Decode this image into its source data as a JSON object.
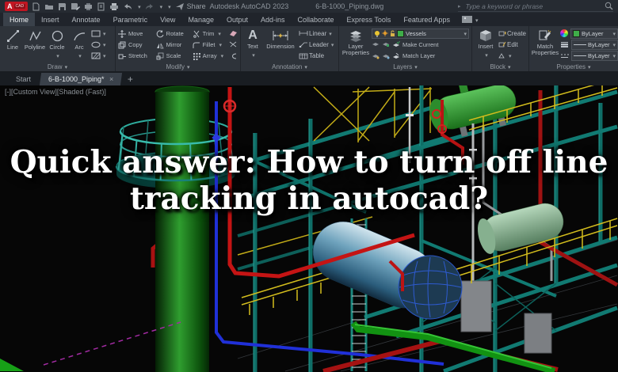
{
  "titlebar": {
    "app_title": "Autodesk AutoCAD 2023",
    "doc_title": "6-B-1000_Piping.dwg",
    "share_label": "Share",
    "search_placeholder": "Type a keyword or phrase",
    "qat_icons": [
      "new-file",
      "open-folder",
      "save",
      "save-as",
      "plot",
      "page",
      "print",
      "undo",
      "redo",
      "share"
    ]
  },
  "ribbon_tabs": {
    "tabs": [
      "Home",
      "Insert",
      "Annotate",
      "Parametric",
      "View",
      "Manage",
      "Output",
      "Add-ins",
      "Collaborate",
      "Express Tools",
      "Featured Apps"
    ],
    "active_tab": "Home"
  },
  "ribbon": {
    "draw": {
      "title": "Draw",
      "buttons": [
        "Line",
        "Polyline",
        "Circle",
        "Arc"
      ]
    },
    "modify": {
      "title": "Modify",
      "items": [
        "Move",
        "Copy",
        "Stretch",
        "Rotate",
        "Mirror",
        "Scale",
        "Trim",
        "Fillet",
        "Array"
      ]
    },
    "annotation": {
      "title": "Annotation",
      "text_label": "Text",
      "dimension_label": "Dimension",
      "items": [
        "Linear",
        "Leader",
        "Table"
      ]
    },
    "layers": {
      "title": "Layers",
      "layer_properties": "Layer Properties",
      "current_layer": "Vessels",
      "make_current": "Make Current",
      "match_layer": "Match Layer",
      "layer_color": "#3fae49"
    },
    "block": {
      "title": "Block",
      "insert": "Insert",
      "create": "Create",
      "edit": "Edit"
    },
    "properties": {
      "title": "Properties",
      "match_properties": "Match Properties",
      "color_value": "ByLayer",
      "linetype_value": "ByLayer",
      "lineweight_value": "ByLayer"
    }
  },
  "file_tabs": {
    "start_tab": "Start",
    "active_tab": "6-B-1000_Piping*",
    "close_label": "×",
    "new_tab_label": "+"
  },
  "viewport": {
    "label": "[-][Custom View][Shaded (Fast)]",
    "scene_palette": {
      "background": "#060606",
      "green_column": "#2f9e2f",
      "structure_teal": "#117a72",
      "railing_yellow": "#d3bd1d",
      "pipe_red": "#c41414",
      "pipe_blue": "#2030d8",
      "vessel_cyan": "#6fa3bd",
      "vessel_green": "#3aa43a",
      "vessel_pale_green": "#8fbf98",
      "pipe_gray": "#b6b8ba",
      "dashed_magenta": "#a22ba2"
    }
  },
  "overlay": {
    "line1": "Quick answer: How to turn off line",
    "line2": "tracking in autocad?",
    "text_color": "#ffffff"
  }
}
